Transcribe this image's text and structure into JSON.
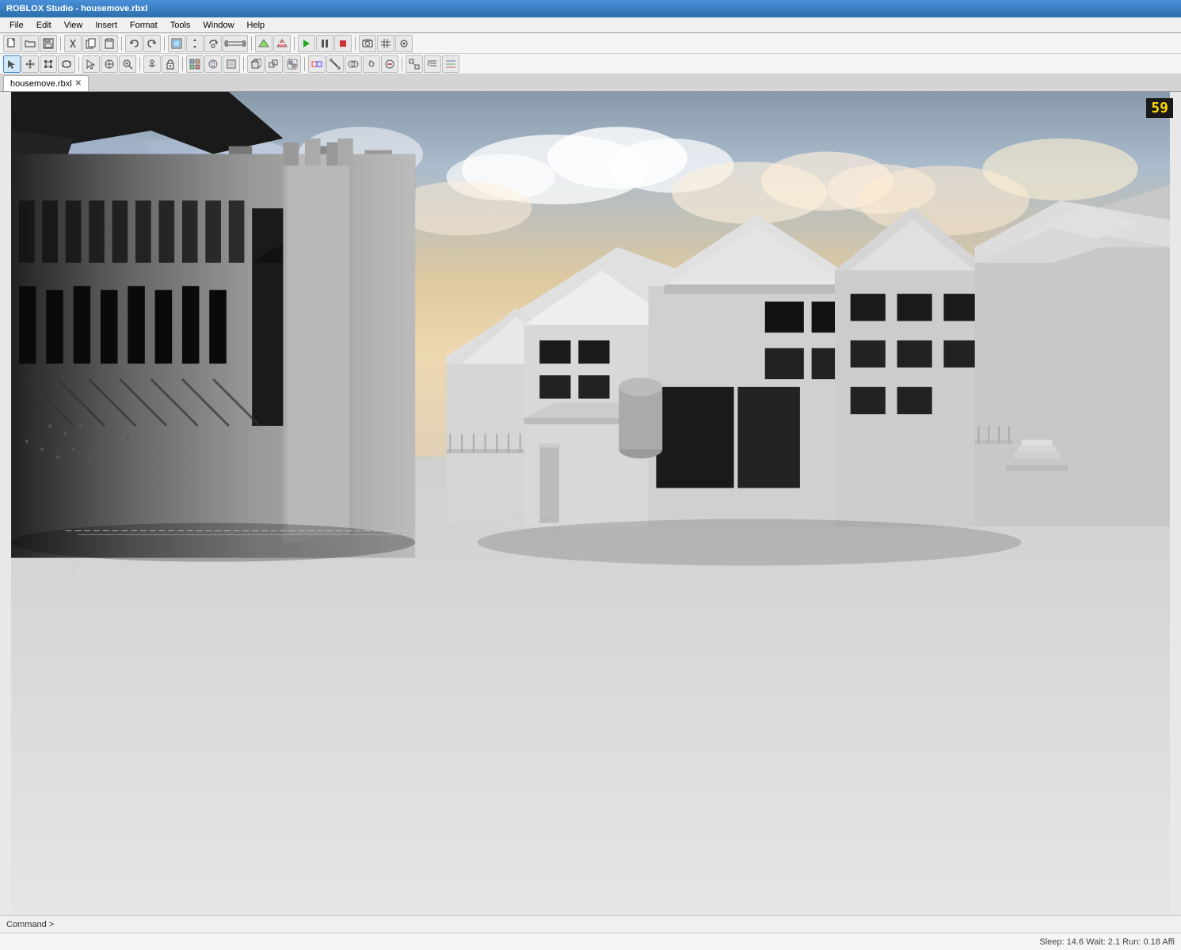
{
  "window": {
    "title": "ROBLOX Studio - housemove.rbxl"
  },
  "menu": {
    "items": [
      "File",
      "Edit",
      "View",
      "Insert",
      "Format",
      "Tools",
      "Window",
      "Help"
    ]
  },
  "toolbar1": {
    "buttons": [
      {
        "name": "new",
        "icon": "📄"
      },
      {
        "name": "open",
        "icon": "📂"
      },
      {
        "name": "save",
        "icon": "💾"
      },
      {
        "name": "cut",
        "icon": "✂"
      },
      {
        "name": "copy",
        "icon": "📋"
      },
      {
        "name": "paste",
        "icon": "📌"
      },
      {
        "name": "undo",
        "icon": "↩"
      },
      {
        "name": "redo",
        "icon": "↪"
      },
      {
        "name": "move",
        "icon": "↔"
      },
      {
        "name": "rotate",
        "icon": "↻"
      },
      {
        "name": "scale",
        "icon": "⤡"
      },
      {
        "name": "select",
        "icon": "▶"
      },
      {
        "name": "terrain",
        "icon": "⛰"
      },
      {
        "name": "play",
        "icon": "▶"
      },
      {
        "name": "pause",
        "icon": "⏸"
      },
      {
        "name": "stop",
        "icon": "⏹"
      }
    ]
  },
  "toolbar2": {
    "buttons": [
      {
        "name": "select-tool",
        "icon": "↖"
      },
      {
        "name": "move-tool",
        "icon": "✥"
      },
      {
        "name": "scale-tool",
        "icon": "⤡"
      },
      {
        "name": "rotate-tool",
        "icon": "↻"
      },
      {
        "name": "grab",
        "icon": "✋"
      },
      {
        "name": "anchor",
        "icon": "⚓"
      },
      {
        "name": "weld",
        "icon": "🔗"
      },
      {
        "name": "material",
        "icon": "🎨"
      },
      {
        "name": "color",
        "icon": "🖌"
      },
      {
        "name": "surface",
        "icon": "▦"
      },
      {
        "name": "decal",
        "icon": "🖼"
      }
    ]
  },
  "tabs": [
    {
      "label": "housemove.rbxl",
      "active": true,
      "closable": true
    }
  ],
  "viewport": {
    "fps": "59",
    "scene_type": "3d_scene"
  },
  "status": {
    "command_label": "Command >",
    "stats": "Sleep: 14.6 Wait: 2.1 Run: 0.18 Affi"
  }
}
